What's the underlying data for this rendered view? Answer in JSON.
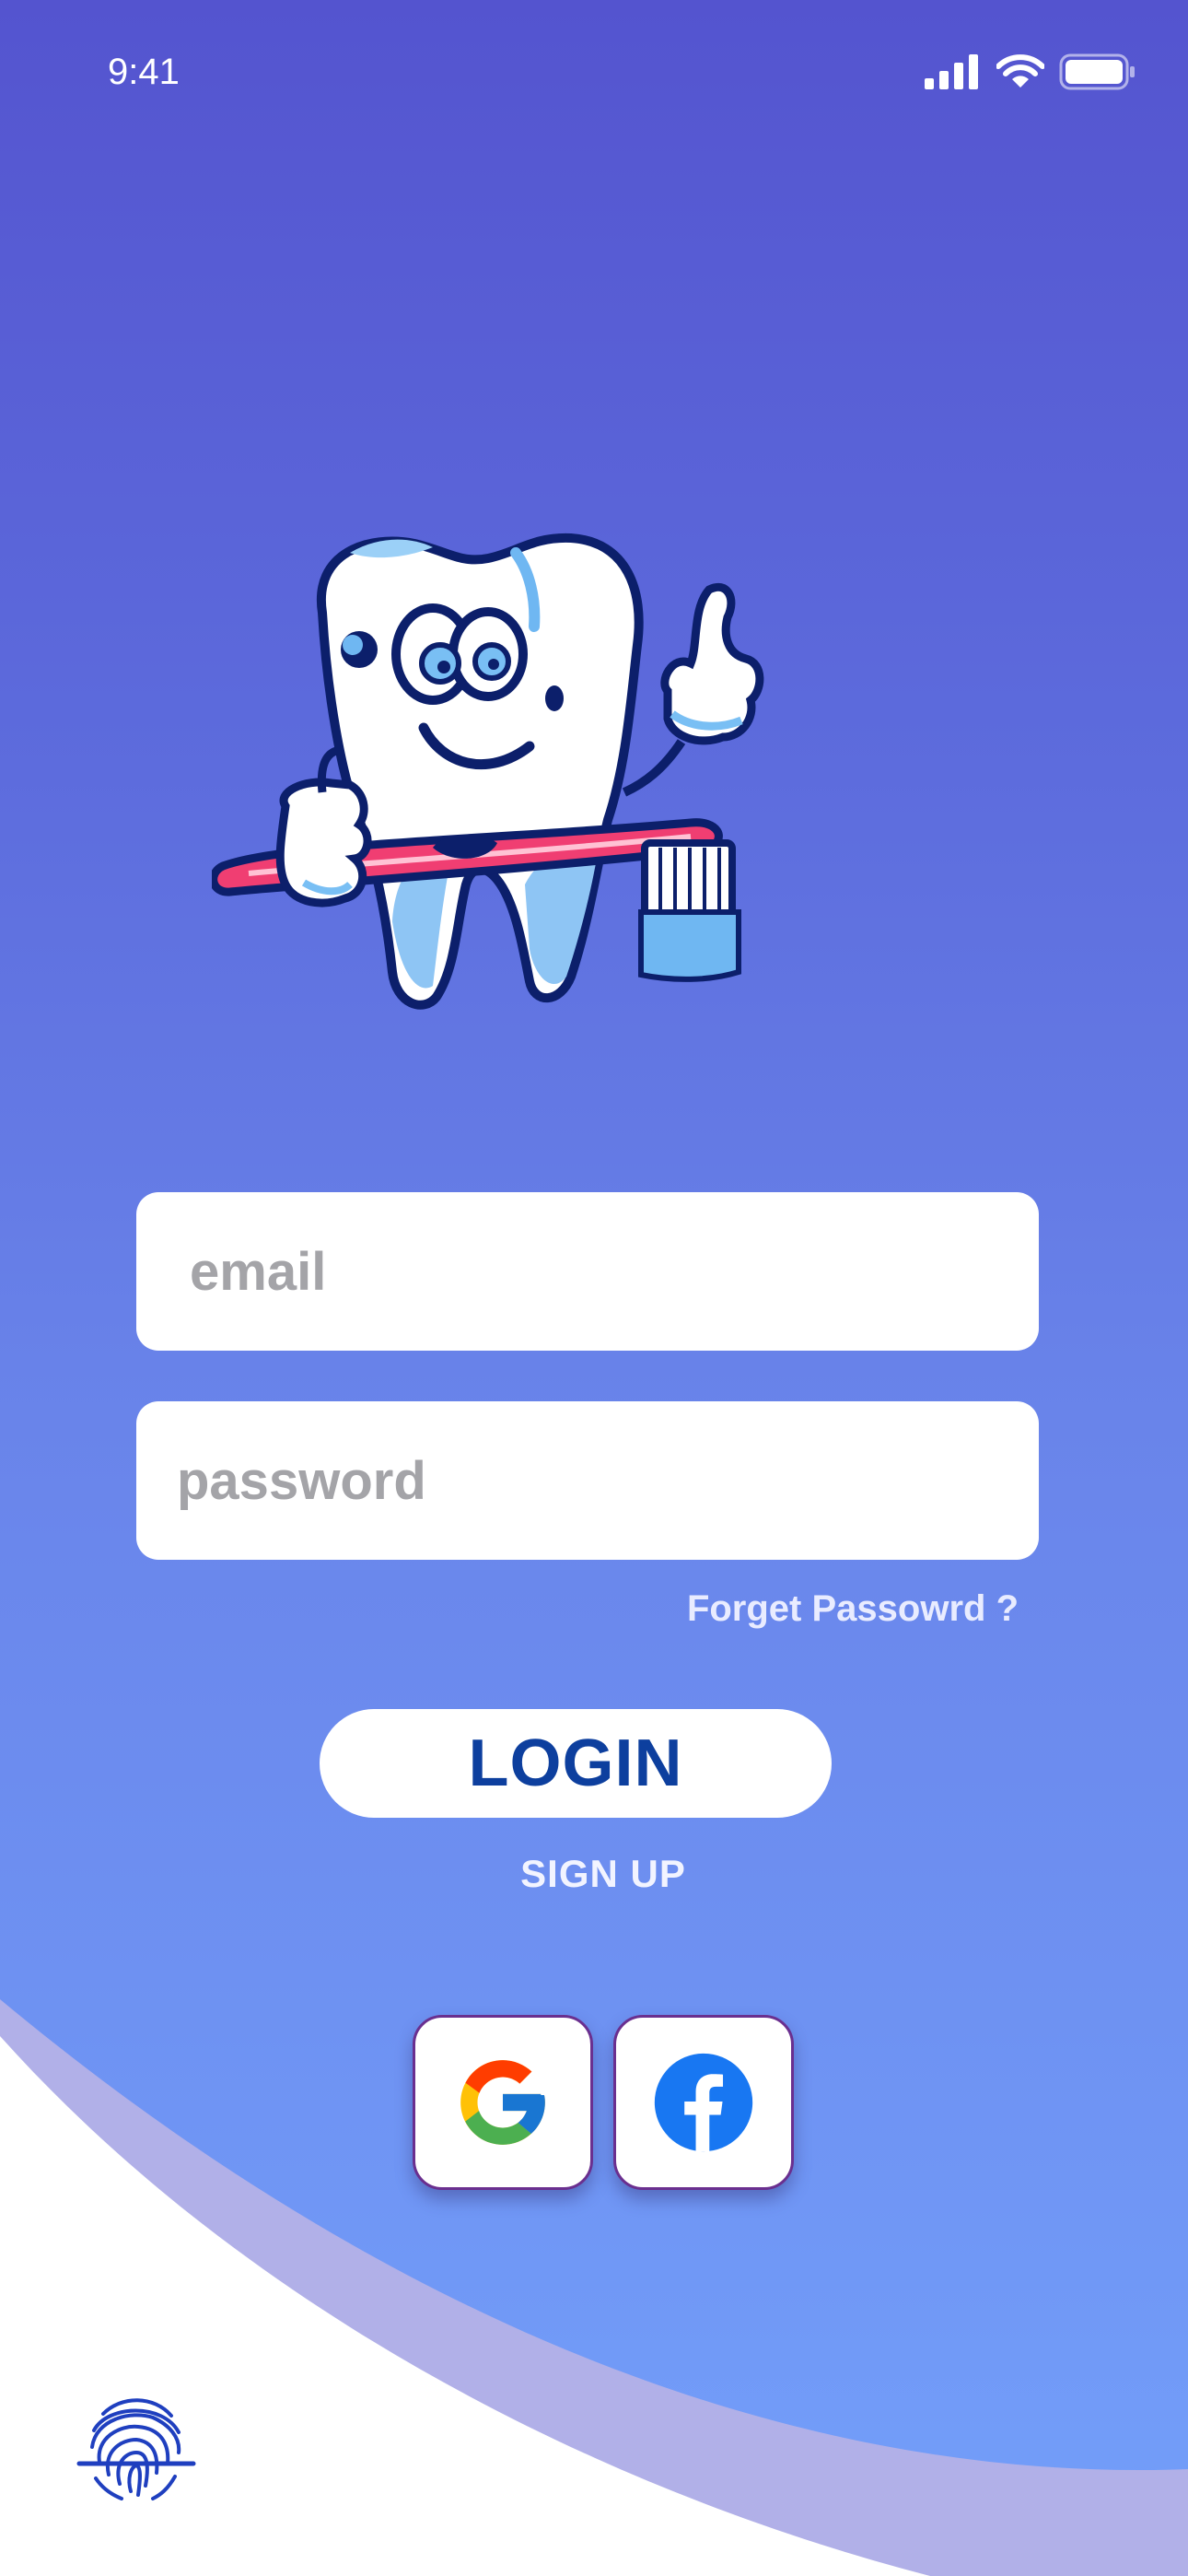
{
  "status_bar": {
    "time": "9:41"
  },
  "login_form": {
    "email_placeholder": "email",
    "password_placeholder": "password",
    "forgot_password_label": "Forget Passowrd ?",
    "login_label": "LOGIN",
    "signup_label": "SIGN UP"
  },
  "social_login": [
    {
      "provider": "google",
      "icon": "google-icon"
    },
    {
      "provider": "facebook",
      "icon": "facebook-icon"
    }
  ],
  "mascot": {
    "icon": "tooth-mascot-with-toothbrush"
  },
  "fingerprint": {
    "icon": "fingerprint-icon"
  },
  "colors": {
    "gradient_top": "#5454cf",
    "gradient_bottom": "#739ffa",
    "login_text": "#0d3f9e",
    "curve_lavender": "#b1b0e8",
    "fingerprint": "#1f3fbf"
  }
}
